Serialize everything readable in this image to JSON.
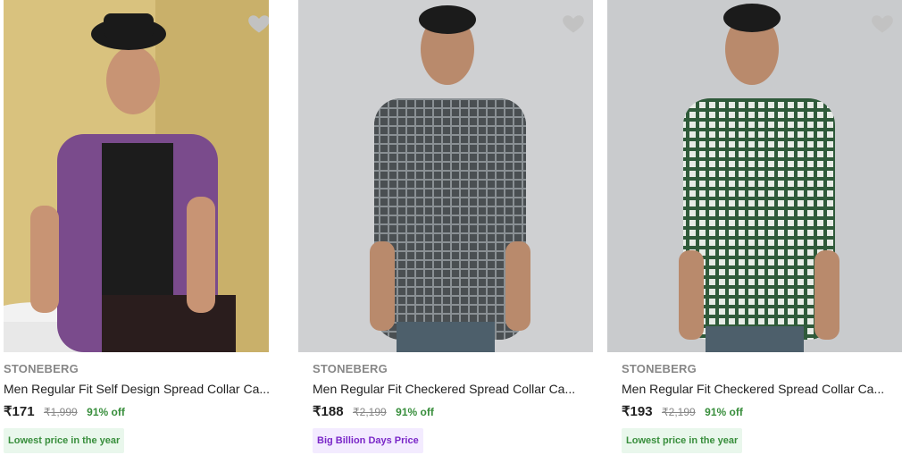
{
  "colors": {
    "green_tag_bg": "#e9f7ec",
    "green_tag_text": "#388e3c",
    "purple_tag_bg": "#f3ebff",
    "purple_tag_text": "#7a27c8",
    "wishlist_heart": "#c2c2c2"
  },
  "products": [
    {
      "brand": "STONEBERG",
      "title": "Men Regular Fit Self Design Spread Collar Ca...",
      "price": "₹171",
      "mrp": "₹1,999",
      "discount": "91% off",
      "tag": "Lowest price in the year",
      "tag_style": "green",
      "image_desc_icon": "product-image"
    },
    {
      "brand": "STONEBERG",
      "title": "Men Regular Fit Checkered Spread Collar Ca...",
      "price": "₹188",
      "mrp": "₹2,199",
      "discount": "91% off",
      "tag": "Big Billion Days Price",
      "tag_style": "purple",
      "image_desc_icon": "product-image"
    },
    {
      "brand": "STONEBERG",
      "title": "Men Regular Fit Checkered Spread Collar Ca...",
      "price": "₹193",
      "mrp": "₹2,199",
      "discount": "91% off",
      "tag": "Lowest price in the year",
      "tag_style": "green",
      "image_desc_icon": "product-image"
    }
  ]
}
